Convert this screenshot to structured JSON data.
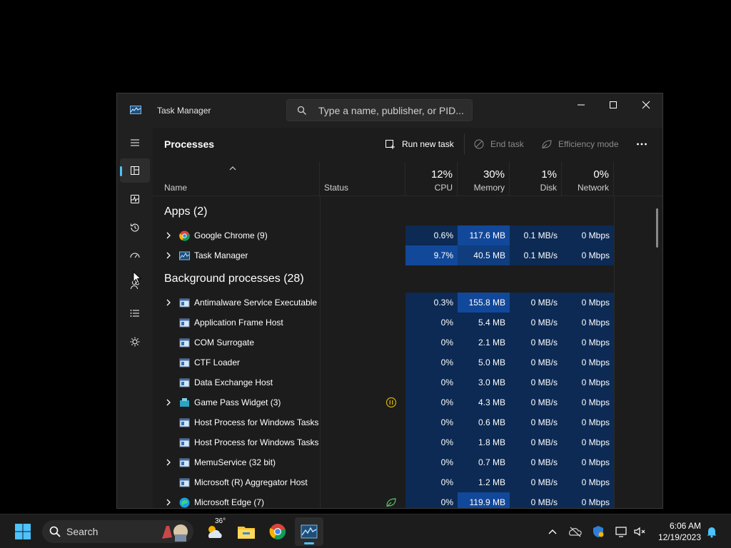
{
  "window": {
    "title": "Task Manager",
    "search_placeholder": "Type a name, publisher, or PID...",
    "controls": [
      "minimize",
      "maximize",
      "close"
    ]
  },
  "nav": {
    "items": [
      {
        "name": "hamburger-menu-icon"
      },
      {
        "name": "processes-icon",
        "active": true
      },
      {
        "name": "performance-icon"
      },
      {
        "name": "app-history-icon"
      },
      {
        "name": "startup-apps-icon"
      },
      {
        "name": "users-icon"
      },
      {
        "name": "details-icon"
      },
      {
        "name": "services-icon"
      }
    ],
    "settings": "settings-gear-icon"
  },
  "toolbar": {
    "title": "Processes",
    "run_new_task": "Run new task",
    "end_task": "End task",
    "efficiency_mode": "Efficiency mode"
  },
  "columns": {
    "name": "Name",
    "status": "Status",
    "cpu": {
      "pct": "12%",
      "label": "CPU"
    },
    "memory": {
      "pct": "30%",
      "label": "Memory"
    },
    "disk": {
      "pct": "1%",
      "label": "Disk"
    },
    "network": {
      "pct": "0%",
      "label": "Network"
    }
  },
  "groups": {
    "apps": "Apps (2)",
    "background": "Background processes (28)"
  },
  "apps": [
    {
      "name": "Google Chrome (9)",
      "cpu": "0.6%",
      "memory": "117.6 MB",
      "disk": "0.1 MB/s",
      "network": "0 Mbps",
      "expandable": true,
      "icon": "chrome-icon"
    },
    {
      "name": "Task Manager",
      "cpu": "9.7%",
      "memory": "40.5 MB",
      "disk": "0.1 MB/s",
      "network": "0 Mbps",
      "expandable": true,
      "icon": "task-manager-icon"
    }
  ],
  "background": [
    {
      "name": "Antimalware Service Executable",
      "cpu": "0.3%",
      "memory": "155.8 MB",
      "disk": "0 MB/s",
      "network": "0 Mbps",
      "expandable": true
    },
    {
      "name": "Application Frame Host",
      "cpu": "0%",
      "memory": "5.4 MB",
      "disk": "0 MB/s",
      "network": "0 Mbps",
      "expandable": false
    },
    {
      "name": "COM Surrogate",
      "cpu": "0%",
      "memory": "2.1 MB",
      "disk": "0 MB/s",
      "network": "0 Mbps",
      "expandable": false
    },
    {
      "name": "CTF Loader",
      "cpu": "0%",
      "memory": "5.0 MB",
      "disk": "0 MB/s",
      "network": "0 Mbps",
      "expandable": false
    },
    {
      "name": "Data Exchange Host",
      "cpu": "0%",
      "memory": "3.0 MB",
      "disk": "0 MB/s",
      "network": "0 Mbps",
      "expandable": false
    },
    {
      "name": "Game Pass Widget (3)",
      "cpu": "0%",
      "memory": "4.3 MB",
      "disk": "0 MB/s",
      "network": "0 Mbps",
      "expandable": true,
      "status": "suspended"
    },
    {
      "name": "Host Process for Windows Tasks",
      "cpu": "0%",
      "memory": "0.6 MB",
      "disk": "0 MB/s",
      "network": "0 Mbps",
      "expandable": false
    },
    {
      "name": "Host Process for Windows Tasks",
      "cpu": "0%",
      "memory": "1.8 MB",
      "disk": "0 MB/s",
      "network": "0 Mbps",
      "expandable": false
    },
    {
      "name": "MemuService (32 bit)",
      "cpu": "0%",
      "memory": "0.7 MB",
      "disk": "0 MB/s",
      "network": "0 Mbps",
      "expandable": true
    },
    {
      "name": "Microsoft (R) Aggregator Host",
      "cpu": "0%",
      "memory": "1.2 MB",
      "disk": "0 MB/s",
      "network": "0 Mbps",
      "expandable": false
    },
    {
      "name": "Microsoft Edge (7)",
      "cpu": "0%",
      "memory": "119.9 MB",
      "disk": "0 MB/s",
      "network": "0 Mbps",
      "expandable": true,
      "status": "efficiency"
    }
  ],
  "taskbar": {
    "search_label": "Search",
    "weather_temp": "36°",
    "time": "6:06 AM",
    "date": "12/19/2023",
    "pinned": [
      "start-icon",
      "weather-icon",
      "file-explorer-icon",
      "chrome-icon",
      "task-manager-icon"
    ]
  }
}
